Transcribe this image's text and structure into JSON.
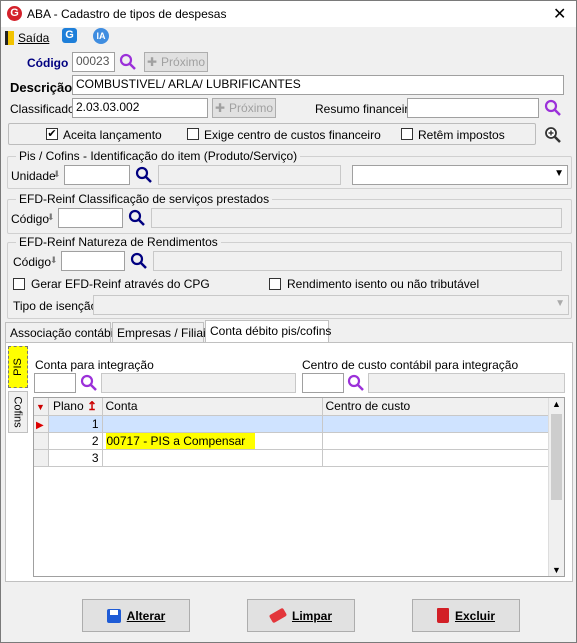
{
  "window": {
    "title": "ABA - Cadastro de tipos de despesas"
  },
  "toolbar": {
    "exit_label": "Saída",
    "g_icon": "G",
    "ia_icon": "IA"
  },
  "codigo": {
    "label": "Código",
    "value": "00023",
    "next_label": "Próximo"
  },
  "descricao": {
    "label": "Descrição",
    "value": "COMBUSTIVEL/ ARLA/ LUBRIFICANTES"
  },
  "classificador": {
    "label": "Classificador",
    "value": "2.03.03.002",
    "next_label": "Próximo"
  },
  "resumo": {
    "label": "Resumo financeiro",
    "value": ""
  },
  "options": {
    "aceita": "Aceita lançamento",
    "exige": "Exige centro de custos financeiro",
    "retem": "Retêm impostos"
  },
  "pis_cofins": {
    "title": "Pis / Cofins - Identificação do item (Produto/Serviço)",
    "unidade_label": "Unidade"
  },
  "reinf_class": {
    "title": "EFD-Reinf Classificação de serviços prestados",
    "codigo_label": "Código"
  },
  "reinf_nat": {
    "title": "EFD-Reinf Natureza de Rendimentos",
    "codigo_label": "Código",
    "gerar": "Gerar EFD-Reinf através do CPG",
    "isento": "Rendimento isento ou não tributável",
    "tipo_label": "Tipo de isenção"
  },
  "tabs": [
    "Associação contábil",
    "Empresas / Filiais",
    "Conta débito pis/cofins"
  ],
  "side_tabs": [
    "PIS",
    "Cofins"
  ],
  "conta_integ": {
    "label": "Conta para integração"
  },
  "centro_integ": {
    "label": "Centro de custo contábil para integração"
  },
  "grid": {
    "headers": [
      "Plano",
      "Conta",
      "Centro de custo"
    ],
    "rows": [
      {
        "plano": "1",
        "conta": "",
        "centro": ""
      },
      {
        "plano": "2",
        "conta": "00717 - PIS a Compensar",
        "centro": ""
      },
      {
        "plano": "3",
        "conta": "",
        "centro": ""
      }
    ]
  },
  "footer": {
    "alterar": "Alterar",
    "limpar": "Limpar",
    "excluir": "Excluir"
  },
  "colors": {
    "accent": "#9b30d9",
    "highlight": "#ffff00"
  }
}
